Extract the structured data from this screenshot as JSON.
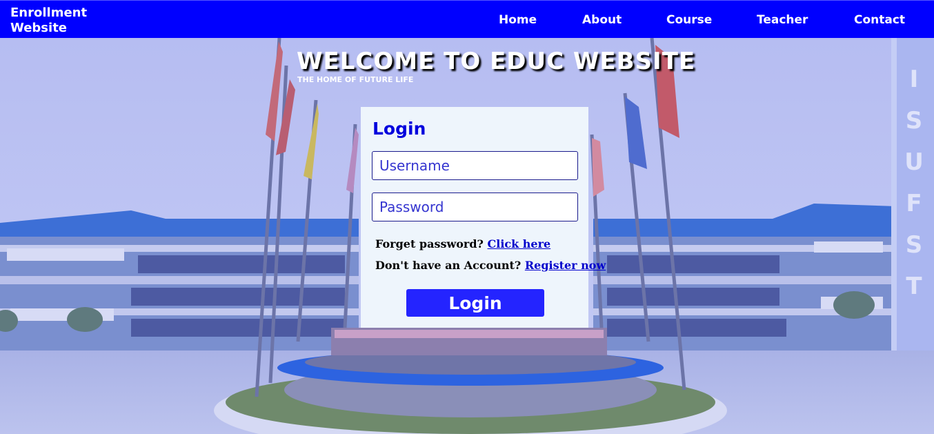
{
  "nav": {
    "brand_line1": "Enrollment",
    "brand_line2": "Website",
    "links": [
      "Home",
      "About",
      "Course",
      "Teacher",
      "Contact"
    ]
  },
  "hero": {
    "title": "WELCOME TO EDUC WEBSITE",
    "subtitle": "THE HOME OF FUTURE LIFE"
  },
  "login": {
    "title": "Login",
    "username_placeholder": "Username",
    "password_placeholder": "Password",
    "forgot_text": "Forget password?",
    "forgot_link": "Click here",
    "register_text": "Don't have an Account?",
    "register_link": "Register now",
    "button_label": "Login"
  },
  "background": {
    "sign_letters": [
      "I",
      "S",
      "U",
      "F",
      "S",
      "T"
    ]
  },
  "colors": {
    "nav_bg": "#0000ff",
    "accent": "#2424ff",
    "card_bg": "#eef5fc",
    "link": "#0000cc"
  }
}
